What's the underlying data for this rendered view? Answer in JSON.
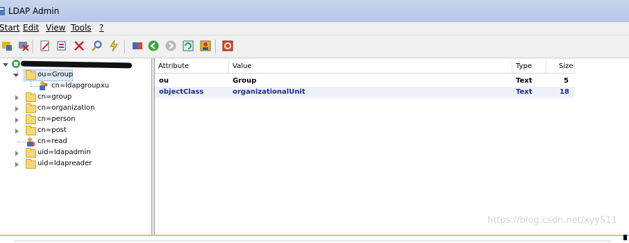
{
  "window": {
    "title": "LDAP Admin"
  },
  "menu": [
    "Start",
    "Edit",
    "View",
    "Tools",
    "?"
  ],
  "toolbar_icons": [
    "connect-icon",
    "disconnect-icon",
    "edit-icon",
    "properties-icon",
    "delete-icon",
    "search-icon",
    "lightning-icon",
    "book-icon",
    "back-icon",
    "forward-icon",
    "refresh-icon",
    "user-icon",
    "exit-icon"
  ],
  "tree": {
    "items": [
      {
        "label": "ou=Group"
      },
      {
        "label": "cn=ldapgroupxu"
      },
      {
        "label": "cn=group"
      },
      {
        "label": "cn=organization"
      },
      {
        "label": "cn=person"
      },
      {
        "label": "cn=post"
      },
      {
        "label": "cn=read"
      },
      {
        "label": "uid=ldapadmin"
      },
      {
        "label": "uid=ldapreader"
      }
    ]
  },
  "attributes": {
    "columns": [
      "Attribute",
      "Value",
      "Type",
      "Size"
    ],
    "rows": [
      {
        "attribute": "ou",
        "value": "Group",
        "type": "Text",
        "size": "5"
      },
      {
        "attribute": "objectClass",
        "value": "organizationalUnit",
        "type": "Text",
        "size": "18"
      }
    ]
  },
  "watermark": "https://blog.csdn.net/xyy511"
}
